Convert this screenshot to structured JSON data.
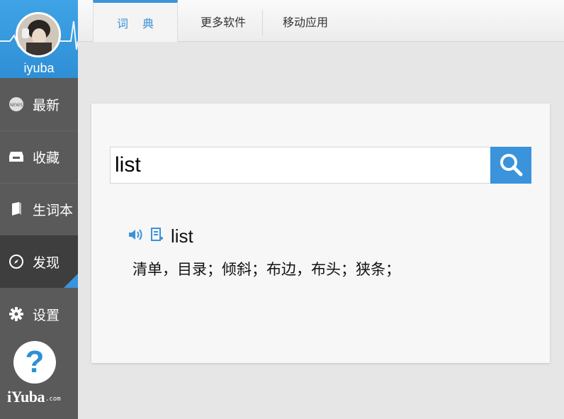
{
  "profile": {
    "username": "iyuba"
  },
  "sidebar": {
    "items": [
      {
        "label": "最新",
        "icon": "news-icon"
      },
      {
        "label": "收藏",
        "icon": "inbox-icon"
      },
      {
        "label": "生词本",
        "icon": "notebook-icon"
      },
      {
        "label": "发现",
        "icon": "compass-icon",
        "active": true
      },
      {
        "label": "设置",
        "icon": "gear-icon"
      }
    ],
    "help_label": "?",
    "logo_text": "iYuba",
    "logo_domain": ".com"
  },
  "tabs": [
    {
      "label": "词典",
      "active": true
    },
    {
      "label": "更多软件"
    },
    {
      "label": "移动应用"
    }
  ],
  "search": {
    "value": "list"
  },
  "result": {
    "word": "list",
    "definition": "清单，目录；倾斜；布边，布头；狭条；"
  },
  "colors": {
    "accent": "#3a93db",
    "sidebar": "#5a5a5a",
    "sidebar_active": "#3e3e3e"
  }
}
